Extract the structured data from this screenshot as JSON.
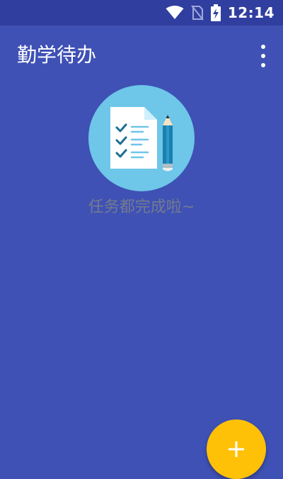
{
  "status_bar": {
    "time": "12:14",
    "icons": [
      "wifi-icon",
      "no-sim-icon",
      "battery-charging-icon"
    ]
  },
  "app_bar": {
    "title": "勤学待办",
    "menu_icon": "more-vert-icon"
  },
  "empty_state": {
    "illustration": "checklist-pencil-icon",
    "message": "任务都完成啦~"
  },
  "fab": {
    "icon": "plus-icon"
  },
  "colors": {
    "primary": "#3F51B5",
    "primary_dark": "#303F9F",
    "accent": "#FFC107",
    "empty_text": "#737A90",
    "illustration_circle": "#6EC6E8"
  }
}
